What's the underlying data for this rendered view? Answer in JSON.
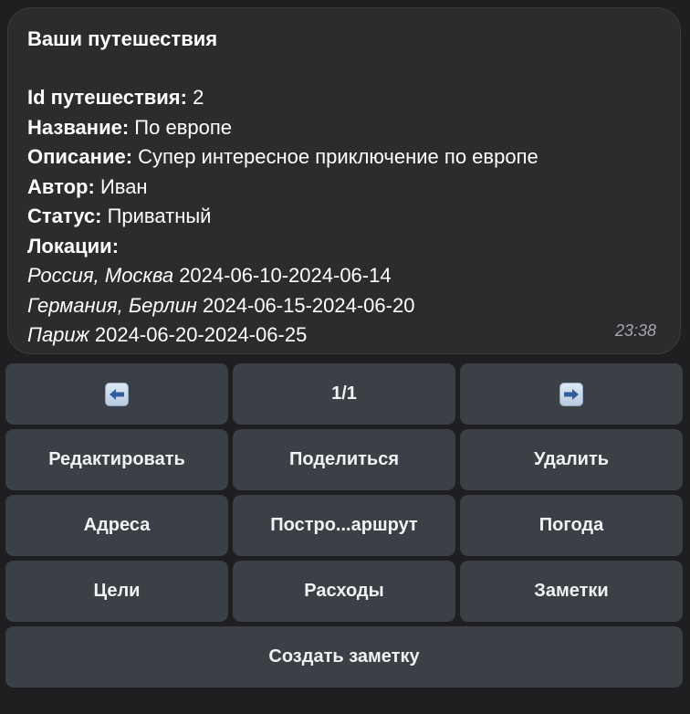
{
  "message": {
    "title": "Ваши путешествия",
    "trip_id_label": "Id путешествия:",
    "trip_id_value": "2",
    "name_label": "Название:",
    "name_value": "По европе",
    "description_label": "Описание:",
    "description_value": "Супер интересное приключение по европе",
    "author_label": "Автор:",
    "author_value": "Иван",
    "status_label": "Статус:",
    "status_value": "Приватный",
    "locations_label": "Локации:",
    "locations": [
      {
        "place": "Россия, Москва",
        "dates": "2024-06-10-2024-06-14"
      },
      {
        "place": "Германия, Берлин",
        "dates": "2024-06-15-2024-06-20"
      },
      {
        "place": "Париж",
        "dates": "2024-06-20-2024-06-25"
      }
    ],
    "time": "23:38"
  },
  "keyboard": {
    "prev_icon": "left-arrow-icon",
    "page": "1/1",
    "next_icon": "right-arrow-icon",
    "edit": "Редактировать",
    "share": "Поделиться",
    "delete": "Удалить",
    "addresses": "Адреса",
    "build_route": "Постро...аршрут",
    "weather": "Погода",
    "goals": "Цели",
    "expenses": "Расходы",
    "notes": "Заметки",
    "create_note": "Создать заметку"
  },
  "colors": {
    "background": "#1f1f21",
    "bubble": "#2c2c2e",
    "button": "#3b3f46",
    "timestamp": "#a6a6ad"
  }
}
